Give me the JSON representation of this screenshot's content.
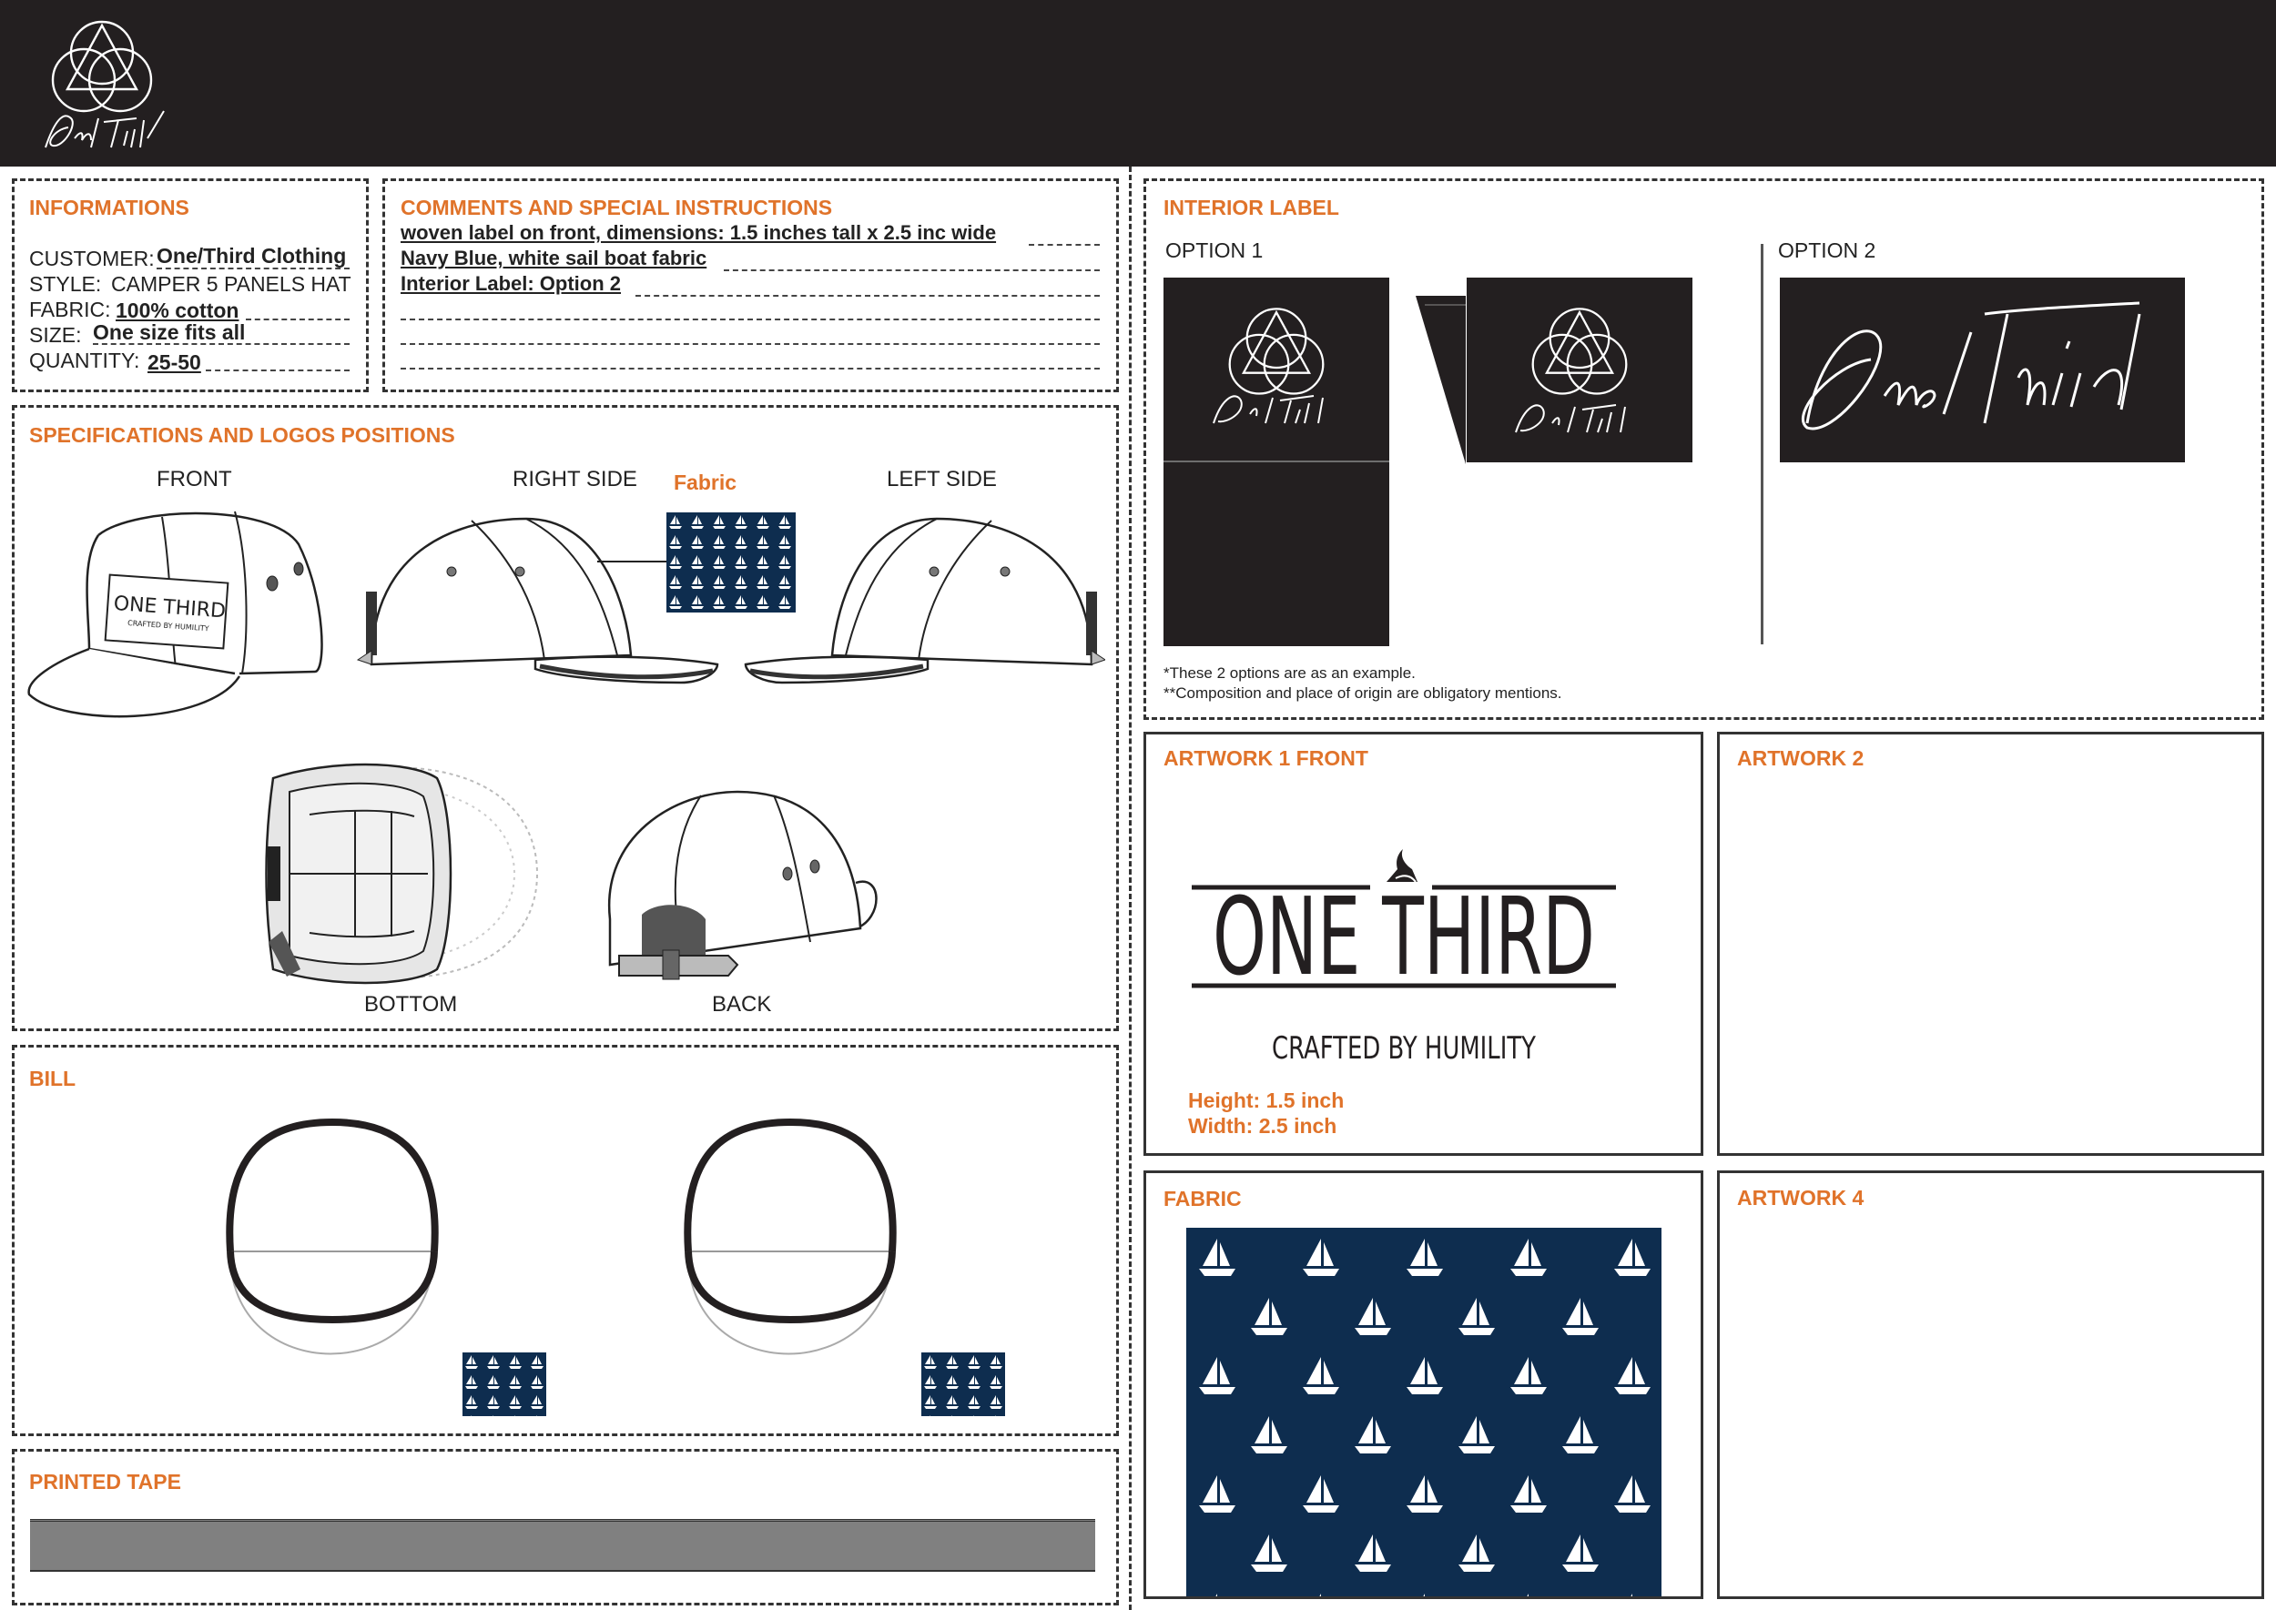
{
  "brand": {
    "logo_text": "One/Third",
    "logo_color": "#231f20"
  },
  "informations": {
    "title": "INFORMATIONS",
    "customer_label": "CUSTOMER:",
    "customer_value": "One/Third Clothing",
    "style_label": "STYLE:",
    "style_value": "CAMPER 5 PANELS HAT",
    "fabric_label": "FABRIC:",
    "fabric_value": "100% cotton",
    "size_label": "SIZE:",
    "size_value": "One size fits all",
    "quantity_label": "QUANTITY:",
    "quantity_value": "25-50"
  },
  "comments": {
    "title": "COMMENTS AND SPECIAL INSTRUCTIONS",
    "lines": [
      "woven label on front, dimensions: 1.5 inches tall x 2.5 inc wide",
      "Navy Blue, white sail boat fabric",
      "Interior Label: Option 2"
    ]
  },
  "specifications": {
    "title": "SPECIFICATIONS AND LOGOS POSITIONS",
    "front_label": "FRONT",
    "right_side_label": "RIGHT SIDE",
    "fabric_label": "Fabric",
    "left_side_label": "LEFT SIDE",
    "bottom_label": "BOTTOM",
    "back_label": "BACK",
    "front_patch_main": "ONE THIRD",
    "front_patch_sub": "CRAFTED BY HUMILITY"
  },
  "bill": {
    "title": "BILL"
  },
  "printed_tape": {
    "title": "PRINTED TAPE",
    "tape_color": "#808080"
  },
  "interior_label": {
    "title": "INTERIOR LABEL",
    "option1_label": "OPTION 1",
    "option2_label": "OPTION 2",
    "note1": "*These 2 options are as an example.",
    "note2": "**Composition and place of origin are obligatory mentions."
  },
  "artwork1": {
    "title": "ARTWORK 1 FRONT",
    "main_text": "ONE THIRD",
    "sub_text": "CRAFTED BY HUMILITY",
    "height": "Height: 1.5 inch",
    "width": "Width: 2.5 inch"
  },
  "artwork2": {
    "title": "ARTWORK 2"
  },
  "fabric_panel": {
    "title": "FABRIC",
    "navy": "#0e2d4f"
  },
  "artwork4": {
    "title": "ARTWORK 4"
  },
  "colors": {
    "accent": "#e0732a",
    "header_bg": "#231f20",
    "fabric_navy": "#0e2d4f"
  }
}
